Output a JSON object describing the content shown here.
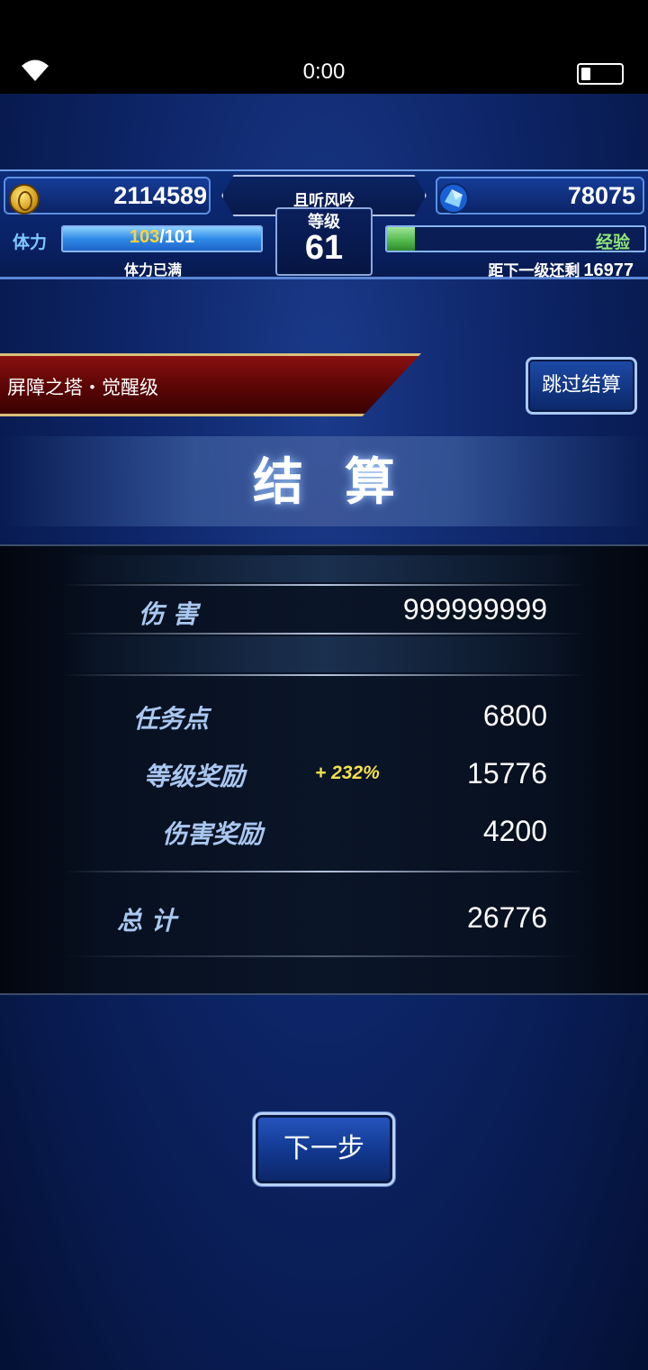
{
  "status_bar": {
    "time": "0:00"
  },
  "header": {
    "gold": "2114589",
    "gems": "78075",
    "player_name": "且听风吟",
    "level_label": "等级",
    "level": "61",
    "stamina_label": "体力",
    "stamina_current": "103",
    "stamina_max": "/101",
    "stamina_fill_fraction": 1.0,
    "stamina_status": "体力已满",
    "exp_label": "经验",
    "exp_fill_fraction": 0.11,
    "exp_next_label": "距下一级还剩",
    "exp_next_value": "16977"
  },
  "stage": {
    "name": "屏障之塔・觉醒级"
  },
  "skip_button": {
    "label": "跳过结算"
  },
  "result": {
    "title": "结算",
    "damage_label": "伤 害",
    "damage_value": "999999999",
    "mission_points_label": "任务点",
    "mission_points_value": "6800",
    "level_bonus_label": "等级奖励",
    "level_bonus_percent": "+ 232%",
    "level_bonus_value": "15776",
    "damage_bonus_label": "伤害奖励",
    "damage_bonus_value": "4200",
    "total_label": "总 计",
    "total_value": "26776"
  },
  "next_button": {
    "label": "下一步"
  },
  "colors": {
    "background": "#0d2466",
    "accent_blue": "#5b8fe0",
    "gold_text": "#ffd23a",
    "bonus_yellow": "#f3e04a",
    "exp_green": "#8ee67a",
    "label_blue": "#a9c7f0",
    "banner_red": "#8a1010"
  }
}
